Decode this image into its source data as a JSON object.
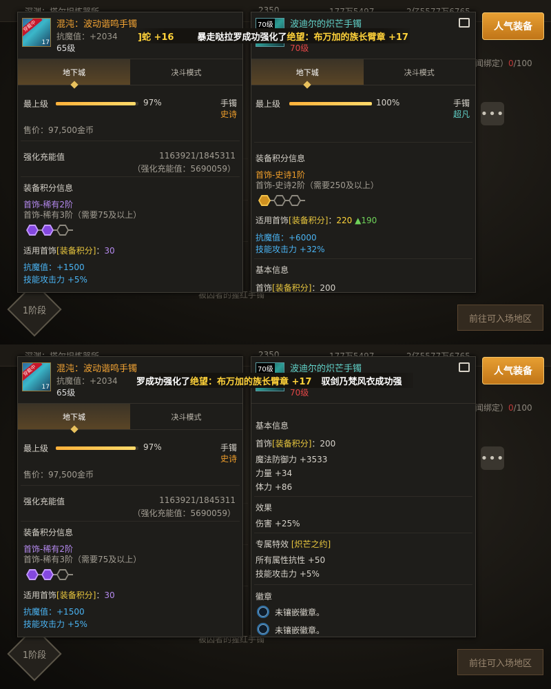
{
  "background": {
    "top_left": "深渊：塔尔坦炼器所",
    "gold": "2350",
    "coins": "177万5497",
    "points": "2亿5577万6765",
    "bound_text": "闻绑定）",
    "bound_count": "0",
    "bound_max": "/100",
    "stage_label": "1阶段",
    "goto_button": "前往可入场地区",
    "hot_button": "人气装备",
    "more_button": "•••",
    "faint_item": "被囚者的猩红手镯"
  },
  "left_panel": {
    "name": "混沌：波动谐鸣手镯",
    "badge": "穿戴中",
    "sub": "抗魔值：+2034",
    "level": "65级",
    "icon_level": "17",
    "tabs": [
      "地下城",
      "决斗模式"
    ],
    "grade_label": "最上级",
    "grade_pct": "97%",
    "grade_value": 0.97,
    "type": "手镯",
    "rarity": "史诗",
    "price": "售价：97,500金币",
    "reinforce_label": "强化充能值",
    "reinforce_value": "1163921/1845311",
    "reinforce_sub": "（强化充能值：5690059）",
    "score_title": "装备积分信息",
    "score_tier": "首饰-稀有2阶",
    "score_next": "首饰-稀有3阶（需要75及以上）",
    "score_prefix": "适用首饰",
    "score_bracket": "[装备积分]",
    "score_colon": "：",
    "score_value": "30",
    "stat1": "抗魔值：+1500",
    "stat2": "技能攻击力 +5%"
  },
  "right_panel_1": {
    "name": "波迪尔的炽芒手镯",
    "icon_tag": "70级",
    "level": "70级",
    "tabs": [
      "地下城",
      "决斗模式"
    ],
    "grade_label": "最上级",
    "grade_pct": "100%",
    "grade_value": 1.0,
    "type": "手镯",
    "rarity": "超凡",
    "score_title": "装备积分信息",
    "score_tier": "首饰-史诗1阶",
    "score_next": "首饰-史诗2阶（需要250及以上）",
    "score_prefix": "适用首饰",
    "score_bracket": "[装备积分]",
    "score_colon": "：",
    "score_value": "220",
    "score_up": "▲190",
    "stat1": "抗魔值：+6000",
    "stat2": "技能攻击力 +32%",
    "basic_title": "基本信息",
    "basic_prefix": "首饰",
    "basic_bracket": "[装备积分]",
    "basic_colon": "：",
    "basic_value": "200"
  },
  "right_panel_2": {
    "name": "波迪尔的炽芒手镯",
    "icon_tag": "70级",
    "level": "70级",
    "basic_title": "基本信息",
    "basic_prefix": "首饰",
    "basic_bracket": "[装备积分]",
    "basic_colon": "：",
    "basic_value": "200",
    "magic_def": "魔法防御力 +3533",
    "str": "力量 +34",
    "vit": "体力 +86",
    "effect_title": "效果",
    "effect_dmg": "伤害 +25%",
    "special_title": "专属特效",
    "special_name": "[炽芒之约]",
    "special_1": "所有属性抗性 +50",
    "special_2": "技能攻击力 +5%",
    "emblem_title": "徽章",
    "emblem_1": "未镶嵌徽章。",
    "emblem_2": "未镶嵌徽章。"
  },
  "banner_top": {
    "a": "]蛇 +16",
    "b": "暴走哒拉罗成功强化了",
    "c": "绝望：布万加的族长臂章 +17"
  },
  "banner_bottom": {
    "a": "罗成功强化了",
    "b": "绝望：布万加的族长臂章 +17",
    "c": "驭剑乃梵风衣成功强"
  }
}
